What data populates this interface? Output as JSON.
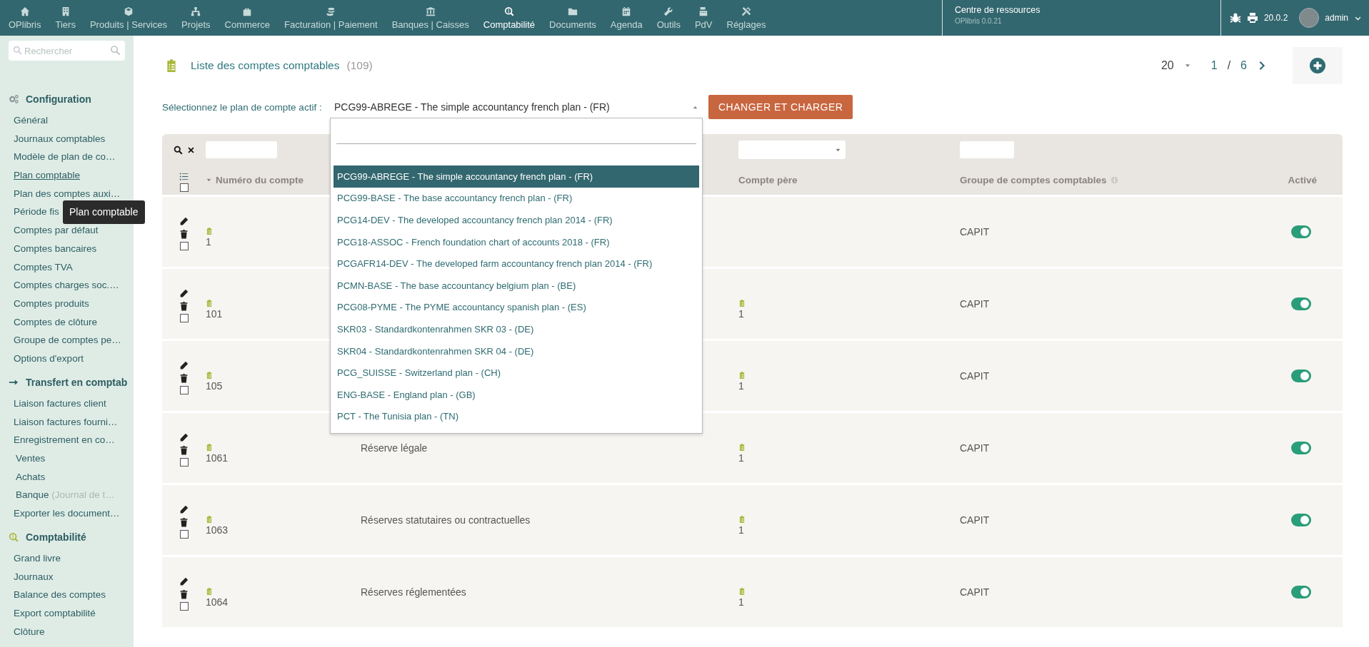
{
  "top_nav": {
    "items": [
      {
        "label": "OPlibris",
        "selected": false
      },
      {
        "label": "Tiers",
        "selected": false
      },
      {
        "label": "Produits | Services",
        "selected": false
      },
      {
        "label": "Projets",
        "selected": false
      },
      {
        "label": "Commerce",
        "selected": false
      },
      {
        "label": "Facturation | Paiement",
        "selected": false
      },
      {
        "label": "Banques | Caisses",
        "selected": false
      },
      {
        "label": "Comptabilité",
        "selected": true
      },
      {
        "label": "Documents",
        "selected": false
      },
      {
        "label": "Agenda",
        "selected": false
      },
      {
        "label": "Outils",
        "selected": false
      },
      {
        "label": "PdV",
        "selected": false
      },
      {
        "label": "Réglages",
        "selected": false
      }
    ],
    "resource_center": {
      "title": "Centre de ressources",
      "subtitle": "OPlibris 0.0.21"
    },
    "version": "20.0.2",
    "user": "admin"
  },
  "sidebar": {
    "search": {
      "placeholder": "Rechercher"
    },
    "sections": [
      {
        "title": "Configuration",
        "items": [
          {
            "label": "Général",
            "hovered": false
          },
          {
            "label": "Journaux comptables",
            "hovered": false
          },
          {
            "label": "Modèle de plan de co…",
            "hovered": false
          },
          {
            "label": "Plan comptable",
            "hovered": true
          },
          {
            "label": "Plan des comptes auxi…",
            "hovered": false
          },
          {
            "label": "Période fis",
            "hovered": false
          },
          {
            "label": "Comptes par défaut",
            "hovered": false
          },
          {
            "label": "Comptes bancaires",
            "hovered": false
          },
          {
            "label": "Comptes TVA",
            "hovered": false
          },
          {
            "label": "Comptes charges soc.…",
            "hovered": false
          },
          {
            "label": "Comptes produits",
            "hovered": false
          },
          {
            "label": "Comptes de clôture",
            "hovered": false
          },
          {
            "label": "Groupe de comptes pe…",
            "hovered": false
          },
          {
            "label": "Options d'export",
            "hovered": false
          }
        ]
      },
      {
        "title": "Transfert en comptab",
        "items": [
          {
            "label": "Liaison factures client",
            "hovered": false
          },
          {
            "label": "Liaison factures fourni…",
            "hovered": false
          },
          {
            "label": "Enregistrement en co…",
            "hovered": false,
            "children": [
              {
                "label": "Ventes",
                "hovered": false
              },
              {
                "label": "Achats",
                "hovered": false
              },
              {
                "label": "Banque",
                "note": "(Journal de t…",
                "hovered": false
              }
            ]
          },
          {
            "label": "Exporter les document…",
            "hovered": false
          }
        ]
      },
      {
        "title": "Comptabilité",
        "items": [
          {
            "label": "Grand livre",
            "hovered": false
          },
          {
            "label": "Journaux",
            "hovered": false
          },
          {
            "label": "Balance des comptes",
            "hovered": false
          },
          {
            "label": "Export comptabilité",
            "hovered": false
          },
          {
            "label": "Clôture",
            "hovered": false
          }
        ]
      }
    ]
  },
  "tooltip": "Plan comptable",
  "page": {
    "title": "Liste des comptes comptables",
    "count": "(109)",
    "pagination": {
      "page_size": "20",
      "page": "1",
      "separator": "/",
      "pages": "6"
    }
  },
  "plan_select": {
    "label": "Sélectionnez le plan de compte actif :",
    "value": "PCG99-ABREGE - The simple accountancy french plan - (FR)",
    "button": "CHANGER ET CHARGER",
    "expanded": true,
    "options": [
      {
        "label": "PCG99-ABREGE - The simple accountancy french plan - (FR)",
        "selected": true
      },
      {
        "label": "PCG99-BASE - The base accountancy french plan - (FR)",
        "selected": false
      },
      {
        "label": "PCG14-DEV - The developed accountancy french plan 2014 - (FR)",
        "selected": false
      },
      {
        "label": "PCG18-ASSOC - French foundation chart of accounts 2018 - (FR)",
        "selected": false
      },
      {
        "label": "PCGAFR14-DEV - The developed farm accountancy french plan 2014 - (FR)",
        "selected": false
      },
      {
        "label": "PCMN-BASE - The base accountancy belgium plan - (BE)",
        "selected": false
      },
      {
        "label": "PCG08-PYME - The PYME accountancy spanish plan - (ES)",
        "selected": false
      },
      {
        "label": "SKR03 - Standardkontenrahmen SKR 03 - (DE)",
        "selected": false
      },
      {
        "label": "SKR04 - Standardkontenrahmen SKR 04 - (DE)",
        "selected": false
      },
      {
        "label": "PCG_SUISSE - Switzerland plan - (CH)",
        "selected": false
      },
      {
        "label": "ENG-BASE - England plan - (GB)",
        "selected": false
      },
      {
        "label": "PCT - The Tunisia plan - (TN)",
        "selected": false
      }
    ]
  },
  "table": {
    "all_checked": false,
    "columns": [
      {
        "label": "Numéro du compte",
        "sorted": true,
        "info": false
      },
      {
        "label": "Compte père",
        "sorted": false,
        "info": false
      },
      {
        "label": "Groupe de comptes comptables",
        "sorted": false,
        "info": true
      },
      {
        "label": "Activé",
        "sorted": false,
        "info": false
      }
    ],
    "rows": [
      {
        "account": "1",
        "parent": "",
        "group": "CAPIT",
        "active": true,
        "checked": false
      },
      {
        "account": "101",
        "parent": "1",
        "group": "CAPIT",
        "active": true,
        "checked": false
      },
      {
        "account": "105",
        "parent": "1",
        "group": "CAPIT",
        "active": true,
        "checked": false
      },
      {
        "account": "1061",
        "label": "Réserve légale",
        "parent": "1",
        "group": "CAPIT",
        "active": true,
        "checked": false
      },
      {
        "account": "1063",
        "label": "Réserves statutaires ou contractuelles",
        "parent": "1",
        "group": "CAPIT",
        "active": true,
        "checked": false
      },
      {
        "account": "1064",
        "label": "Réserves réglementées",
        "parent": "1",
        "group": "CAPIT",
        "active": true,
        "checked": false
      }
    ]
  }
}
